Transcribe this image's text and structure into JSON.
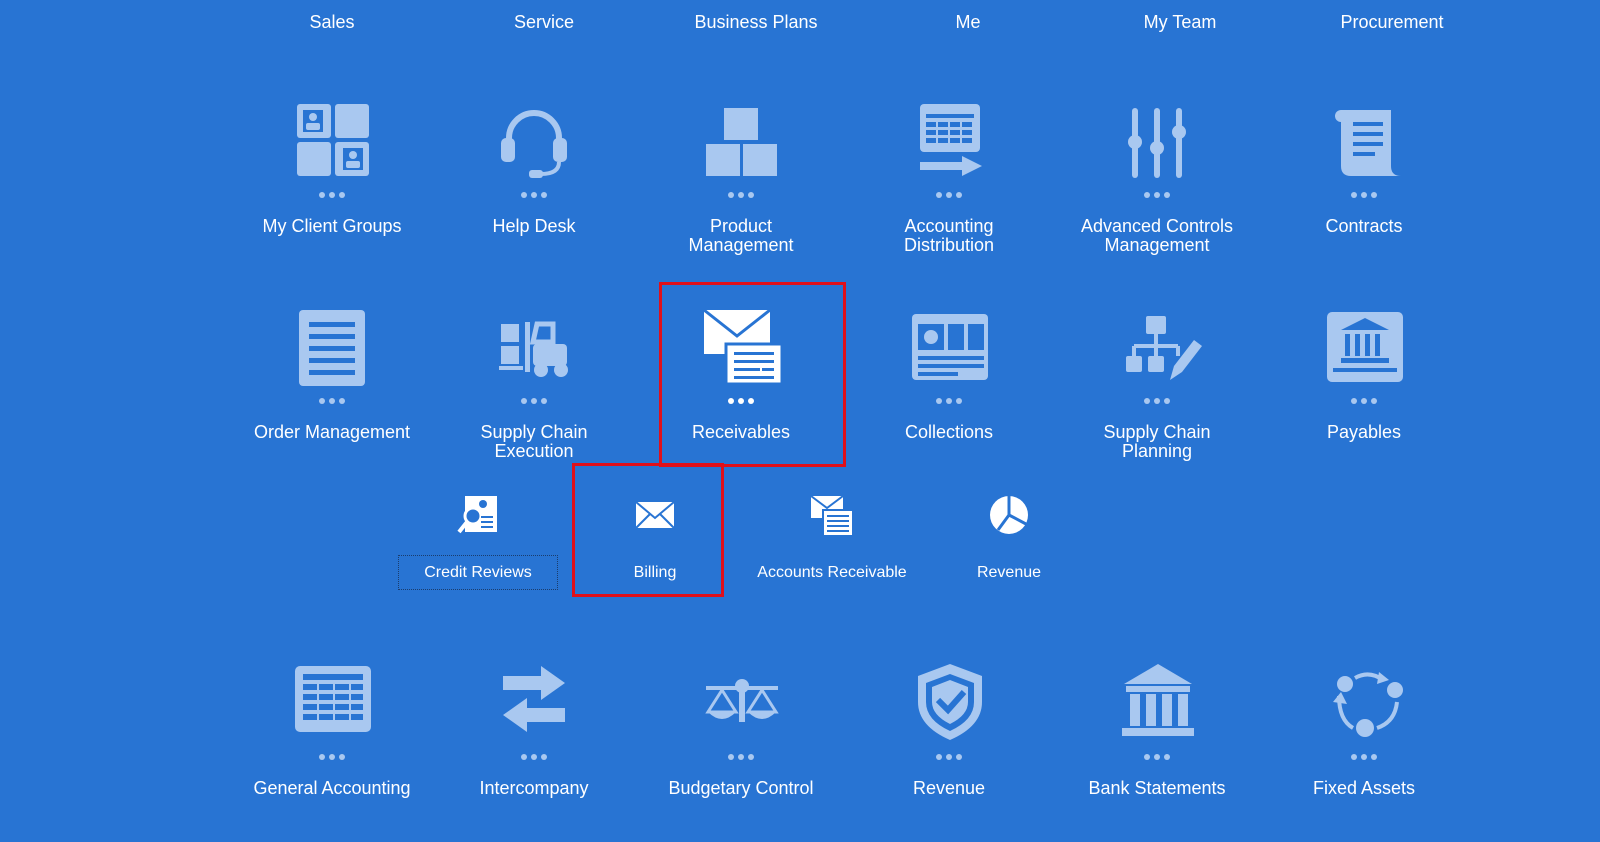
{
  "tabs": [
    "Sales",
    "Service",
    "Business Plans",
    "Me",
    "My Team",
    "Procurement"
  ],
  "row1": [
    {
      "label": "My Client Groups",
      "icon": "client-groups-icon"
    },
    {
      "label": "Help Desk",
      "icon": "headset-icon"
    },
    {
      "label": "Product Management",
      "icon": "boxes-icon"
    },
    {
      "label": "Accounting Distribution",
      "icon": "ledger-arrow-icon"
    },
    {
      "label": "Advanced Controls Management",
      "icon": "sliders-icon"
    },
    {
      "label": "Contracts",
      "icon": "scroll-icon"
    }
  ],
  "row2": [
    {
      "label": "Order Management",
      "icon": "document-icon"
    },
    {
      "label": "Supply Chain Execution",
      "icon": "forklift-icon"
    },
    {
      "label": "Receivables",
      "icon": "envelope-invoice-icon"
    },
    {
      "label": "Collections",
      "icon": "dashboard-icon"
    },
    {
      "label": "Supply Chain Planning",
      "icon": "hierarchy-pencil-icon"
    },
    {
      "label": "Payables",
      "icon": "bank-doc-icon"
    }
  ],
  "receivables_sub": [
    {
      "label": "Credit Reviews",
      "icon": "credit-review-icon"
    },
    {
      "label": "Billing",
      "icon": "envelope-icon"
    },
    {
      "label": "Accounts Receivable",
      "icon": "envelope-invoice-icon"
    },
    {
      "label": "Revenue",
      "icon": "pie-chart-icon"
    }
  ],
  "row3": [
    {
      "label": "General Accounting",
      "icon": "spreadsheet-icon"
    },
    {
      "label": "Intercompany",
      "icon": "swap-arrows-icon"
    },
    {
      "label": "Budgetary Control",
      "icon": "scales-icon"
    },
    {
      "label": "Revenue",
      "icon": "shield-check-icon"
    },
    {
      "label": "Bank Statements",
      "icon": "bank-icon"
    },
    {
      "label": "Fixed Assets",
      "icon": "cycle-icon"
    }
  ],
  "colors": {
    "background": "#2874D3",
    "icon": "#A9C8F0",
    "highlight": "#E0101A"
  }
}
